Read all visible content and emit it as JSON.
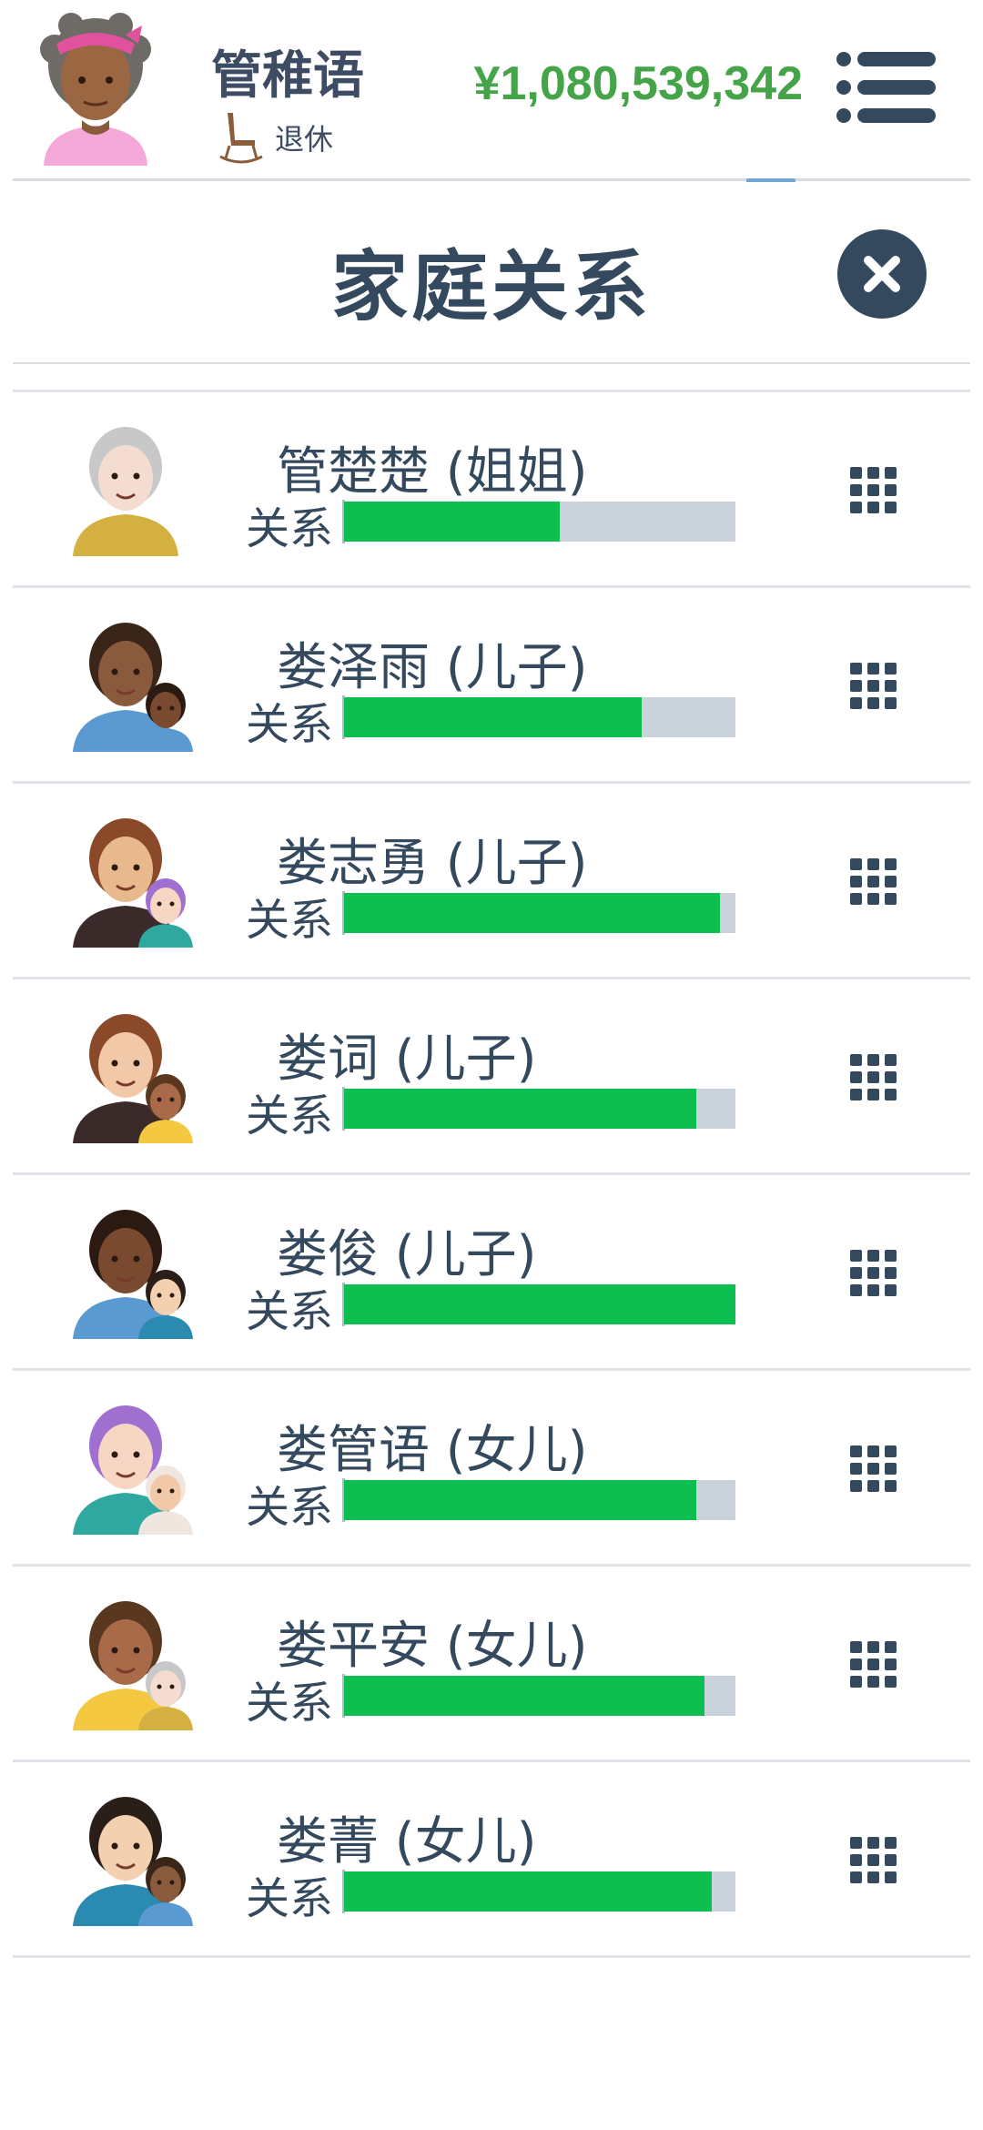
{
  "header": {
    "player_name": "管稚语",
    "status_icon": "rocking-chair-icon",
    "status_text": "退休",
    "money": "¥1,080,539,342",
    "menu_icon": "list-menu-icon"
  },
  "modal": {
    "title": "家庭关系",
    "close_icon": "close-icon"
  },
  "colors": {
    "accent_dark": "#34495e",
    "money_green": "#45a447",
    "bar_fill": "#0cbf50",
    "bar_track": "#cad2db"
  },
  "relationships": [
    {
      "name": "",
      "label": "关系",
      "relationship": 0.54,
      "action_icon": "grid-menu-icon",
      "partial": true
    },
    {
      "name": "管楚楚 (姐姐)",
      "label": "关系",
      "relationship": 0.55,
      "action_icon": "grid-menu-icon"
    },
    {
      "name": "娄泽雨 (儿子)",
      "label": "关系",
      "relationship": 0.76,
      "action_icon": "grid-menu-icon"
    },
    {
      "name": "娄志勇 (儿子)",
      "label": "关系",
      "relationship": 0.96,
      "action_icon": "grid-menu-icon"
    },
    {
      "name": "娄词 (儿子)",
      "label": "关系",
      "relationship": 0.9,
      "action_icon": "grid-menu-icon"
    },
    {
      "name": "娄俊 (儿子)",
      "label": "关系",
      "relationship": 1.0,
      "action_icon": "grid-menu-icon"
    },
    {
      "name": "娄管语 (女儿)",
      "label": "关系",
      "relationship": 0.9,
      "action_icon": "grid-menu-icon"
    },
    {
      "name": "娄平安 (女儿)",
      "label": "关系",
      "relationship": 0.92,
      "action_icon": "grid-menu-icon"
    },
    {
      "name": "娄菁 (女儿)",
      "label": "关系",
      "relationship": 0.94,
      "action_icon": "grid-menu-icon"
    }
  ]
}
